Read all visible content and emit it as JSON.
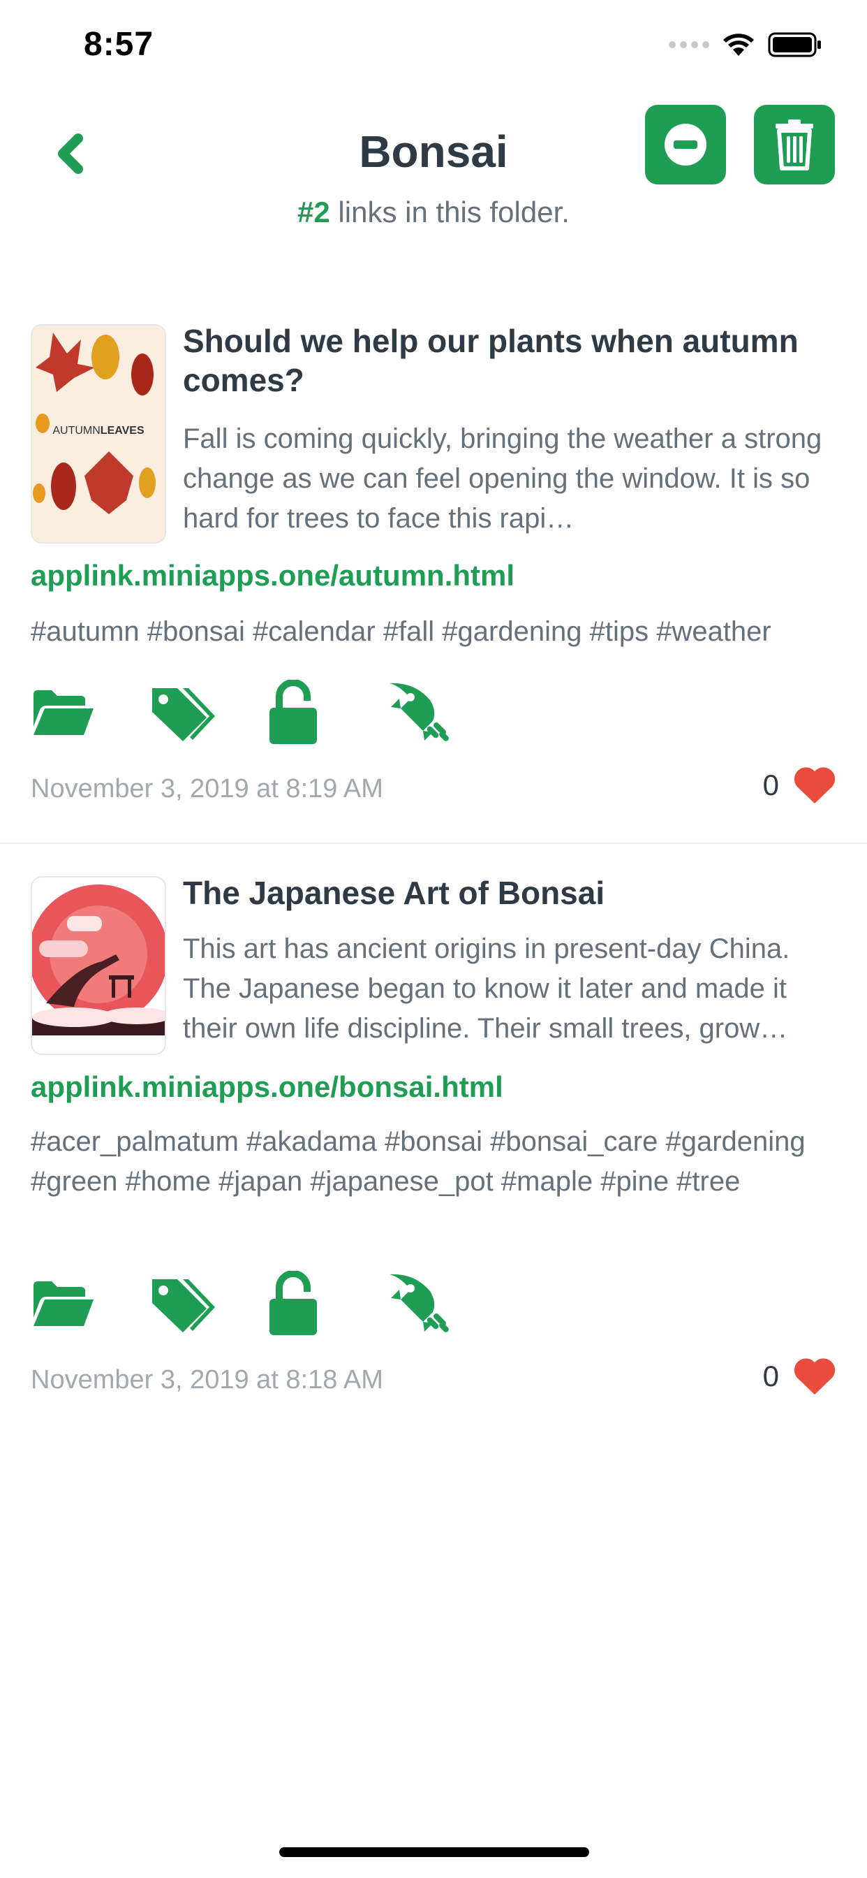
{
  "status": {
    "time": "8:57"
  },
  "header": {
    "title": "Bonsai",
    "count": "#2",
    "subtitle_rest": " links in this folder."
  },
  "colors": {
    "accent": "#1f9d55",
    "heart": "#e74c3c",
    "text": "#2f3a45",
    "muted": "#66707a"
  },
  "links": [
    {
      "thumb_text_a": "AUTUMN",
      "thumb_text_b": "LEAVES",
      "title": "Should we help our plants when autumn comes?",
      "description": "Fall is coming quickly, bringing the weather a strong change as we can feel opening the window. It is so hard for trees to face this rapi…",
      "url": "applink.miniapps.one/autumn.html",
      "tags": "#autumn #bonsai #calendar #fall #gardening #tips #weather",
      "date": "November 3, 2019 at 8:19 AM",
      "likes": "0"
    },
    {
      "title": "The Japanese Art of Bonsai",
      "description": "This art has ancient origins in present-day China. The Japanese began to know it later and made it their own life discipline. Their small trees, grow…",
      "url": "applink.miniapps.one/bonsai.html",
      "tags": "#acer_palmatum #akadama #bonsai #bonsai_care #gardening #green #home #japan #japanese_pot #maple #pine #tree",
      "date": "November 3, 2019 at 8:18 AM",
      "likes": "0"
    }
  ],
  "icons": [
    "chevron-left-icon",
    "minus-circle-icon",
    "trash-icon",
    "folder-open-icon",
    "tags-icon",
    "unlock-icon",
    "rocket-icon",
    "heart-icon"
  ]
}
